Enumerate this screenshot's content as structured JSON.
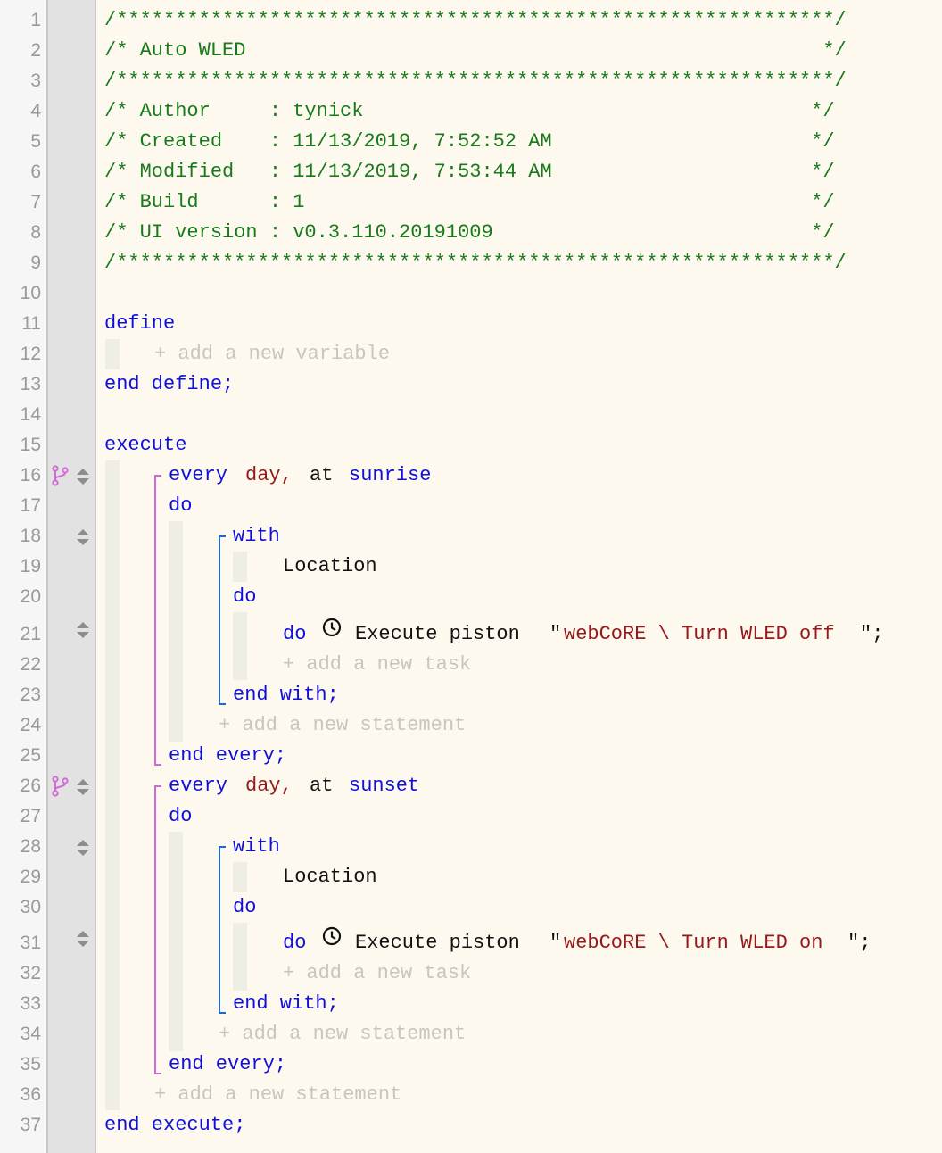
{
  "line_numbers": [
    "1",
    "2",
    "3",
    "4",
    "5",
    "6",
    "7",
    "8",
    "9",
    "10",
    "11",
    "12",
    "13",
    "14",
    "15",
    "16",
    "17",
    "18",
    "19",
    "20",
    "21",
    "22",
    "23",
    "24",
    "25",
    "26",
    "27",
    "28",
    "29",
    "30",
    "31",
    "32",
    "33",
    "34",
    "35",
    "36",
    "37"
  ],
  "header": {
    "border": "/*************************************************************/",
    "title_line": "/* Auto WLED                                                 */",
    "author_line": "/* Author     : tynick                                      */",
    "created_line": "/* Created    : 11/13/2019, 7:52:52 AM                      */",
    "modified_line": "/* Modified   : 11/13/2019, 7:53:44 AM                      */",
    "build_line": "/* Build      : 1                                           */",
    "ui_version_line": "/* UI version : v0.3.110.20191009                           */"
  },
  "define": {
    "start": "define",
    "add_variable": "+ add a new variable",
    "end": "end define;"
  },
  "execute": {
    "start": "execute",
    "add_statement": "+ add a new statement",
    "end": "end execute;",
    "blocks": [
      {
        "every_kw": "every",
        "every_unit": "day,",
        "at_kw": "at",
        "event": "sunrise",
        "do": "do",
        "with_kw": "with",
        "device": "Location",
        "with_do": "do",
        "task_do": "do",
        "task_text": "Execute piston",
        "quote_open": "\"",
        "piston_name": "webCoRE \\ Turn WLED off",
        "quote_close": "\";",
        "add_task": "+ add a new task",
        "end_with": "end with;",
        "add_statement": "+ add a new statement",
        "end_every": "end every;"
      },
      {
        "every_kw": "every",
        "every_unit": "day,",
        "at_kw": "at",
        "event": "sunset",
        "do": "do",
        "with_kw": "with",
        "device": "Location",
        "with_do": "do",
        "task_do": "do",
        "task_text": "Execute piston",
        "quote_open": "\"",
        "piston_name": "webCoRE \\ Turn WLED on",
        "quote_close": "\";",
        "add_task": "+ add a new task",
        "end_with": "end with;",
        "add_statement": "+ add a new statement",
        "end_every": "end every;"
      }
    ]
  },
  "icons": {
    "branch": "fork-icon",
    "move": "reorder-arrows-icon",
    "clock": "clock-icon"
  },
  "colors": {
    "comment": "#197a1c",
    "keyword": "#1010d8",
    "string": "#961818",
    "hint": "#c8c6bc",
    "every_bracket": "#d06ad6",
    "with_bracket": "#1b69d0",
    "background": "#fdf9ee"
  }
}
